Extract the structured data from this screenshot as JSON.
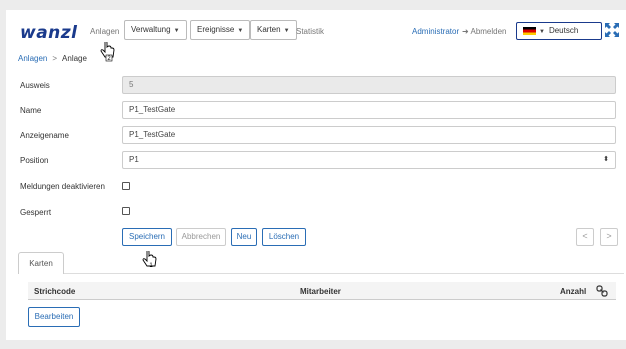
{
  "brand": {
    "logo": "wanzl"
  },
  "nav": {
    "anlagen": "Anlagen",
    "menus": [
      {
        "label": "Verwaltung"
      },
      {
        "label": "Ereignisse"
      },
      {
        "label": "Karten"
      }
    ],
    "statistik": "Statistik",
    "admin": "Administrator",
    "logout": "Abmelden",
    "language": "Deutsch"
  },
  "breadcrumb": {
    "parent": "Anlagen",
    "separator": ">",
    "current": "Anlage"
  },
  "form": {
    "ausweis": {
      "label": "Ausweis",
      "value": "5"
    },
    "name": {
      "label": "Name",
      "value": "P1_TestGate"
    },
    "anzeigename": {
      "label": "Anzeigename",
      "value": "P1_TestGate"
    },
    "position": {
      "label": "Position",
      "value": "P1"
    },
    "meldungen": {
      "label": "Meldungen deaktivieren",
      "checked": false
    },
    "gesperrt": {
      "label": "Gesperrt",
      "checked": false
    }
  },
  "actions": {
    "save": "Speichern",
    "cancel": "Abbrechen",
    "new": "Neu",
    "delete": "Löschen"
  },
  "pager": {
    "prev": "<",
    "next": ">"
  },
  "tabs": {
    "karten": "Karten"
  },
  "table": {
    "columns": [
      "Strichcode",
      "Mitarbeiter",
      "Anzahl"
    ]
  },
  "edit_button": "Bearbeiten",
  "cursor_badges": {
    "top": "2",
    "bottom": "1"
  },
  "colors": {
    "accent": "#2a6db5",
    "brand": "#1a3a8c",
    "readonly_bg": "#eaeaea"
  }
}
